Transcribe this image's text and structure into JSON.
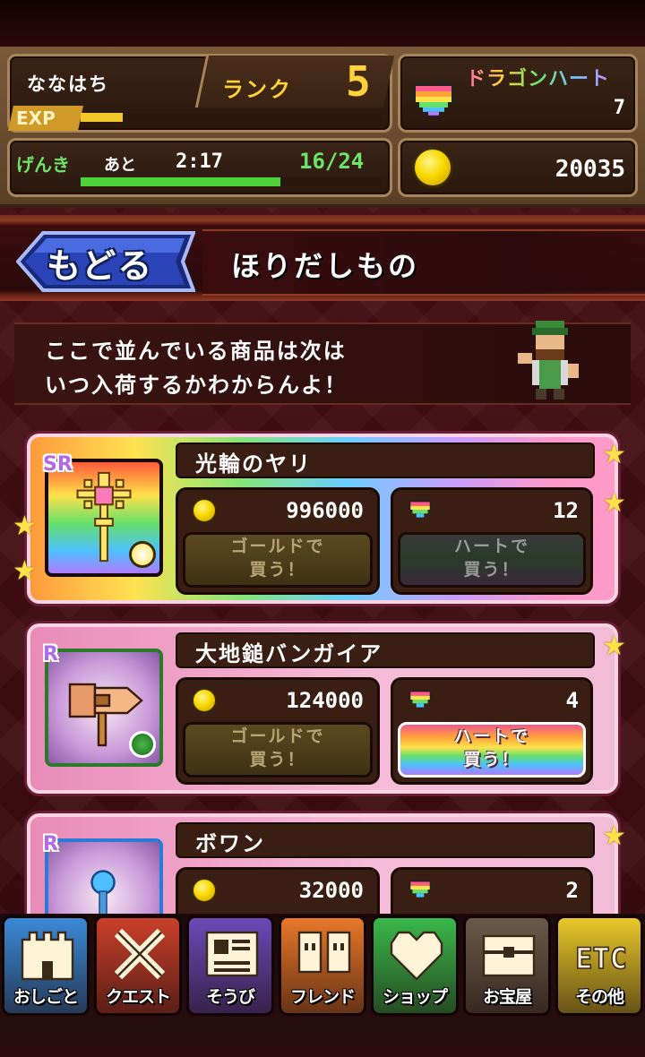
{
  "player": {
    "name": "ななはち",
    "rank_label": "ランク",
    "rank": "5",
    "exp_label": "EXP",
    "exp_progress": 0.14
  },
  "dragon_heart": {
    "label": "ドラゴンハート",
    "value": "7"
  },
  "stamina": {
    "label": "げんき",
    "remaining_label": "あと",
    "timer": "2:17",
    "value": "16/24",
    "progress": 0.667
  },
  "gold": {
    "value": "20035"
  },
  "header": {
    "back_label": "もどる",
    "title": "ほりだしもの"
  },
  "message": {
    "line1": "ここで並んでいる商品は次は",
    "line2": "いつ入荷するかわからんよ！"
  },
  "items": [
    {
      "rarity": "SR",
      "name": "光輪のヤリ",
      "gold_price": "996000",
      "heart_price": "12",
      "gold_buy_label": [
        "ゴールドで",
        "買う！"
      ],
      "heart_buy_label": [
        "ハートで",
        "買う！"
      ]
    },
    {
      "rarity": "R",
      "name": "大地鎚バンガイア",
      "gold_price": "124000",
      "heart_price": "4",
      "gold_buy_label": [
        "ゴールドで",
        "買う！"
      ],
      "heart_buy_label": [
        "ハートで",
        "買う！"
      ]
    },
    {
      "rarity": "R",
      "name": "ボワン",
      "gold_price": "32000",
      "heart_price": "2"
    }
  ],
  "tabs": [
    {
      "label": "おしごと",
      "color": "#3a8ad8"
    },
    {
      "label": "クエスト",
      "color": "#c8402a"
    },
    {
      "label": "そうび",
      "color": "#6a4ab8"
    },
    {
      "label": "フレンド",
      "color": "#e8782a"
    },
    {
      "label": "ショップ",
      "color": "#3ab84a"
    },
    {
      "label": "お宝屋",
      "color": "#6a5a4a"
    },
    {
      "label": "その他",
      "color": "#e8c82a"
    }
  ],
  "colors": {
    "accent_gold": "#ffd23a",
    "stamina_green": "#6ee36a"
  }
}
